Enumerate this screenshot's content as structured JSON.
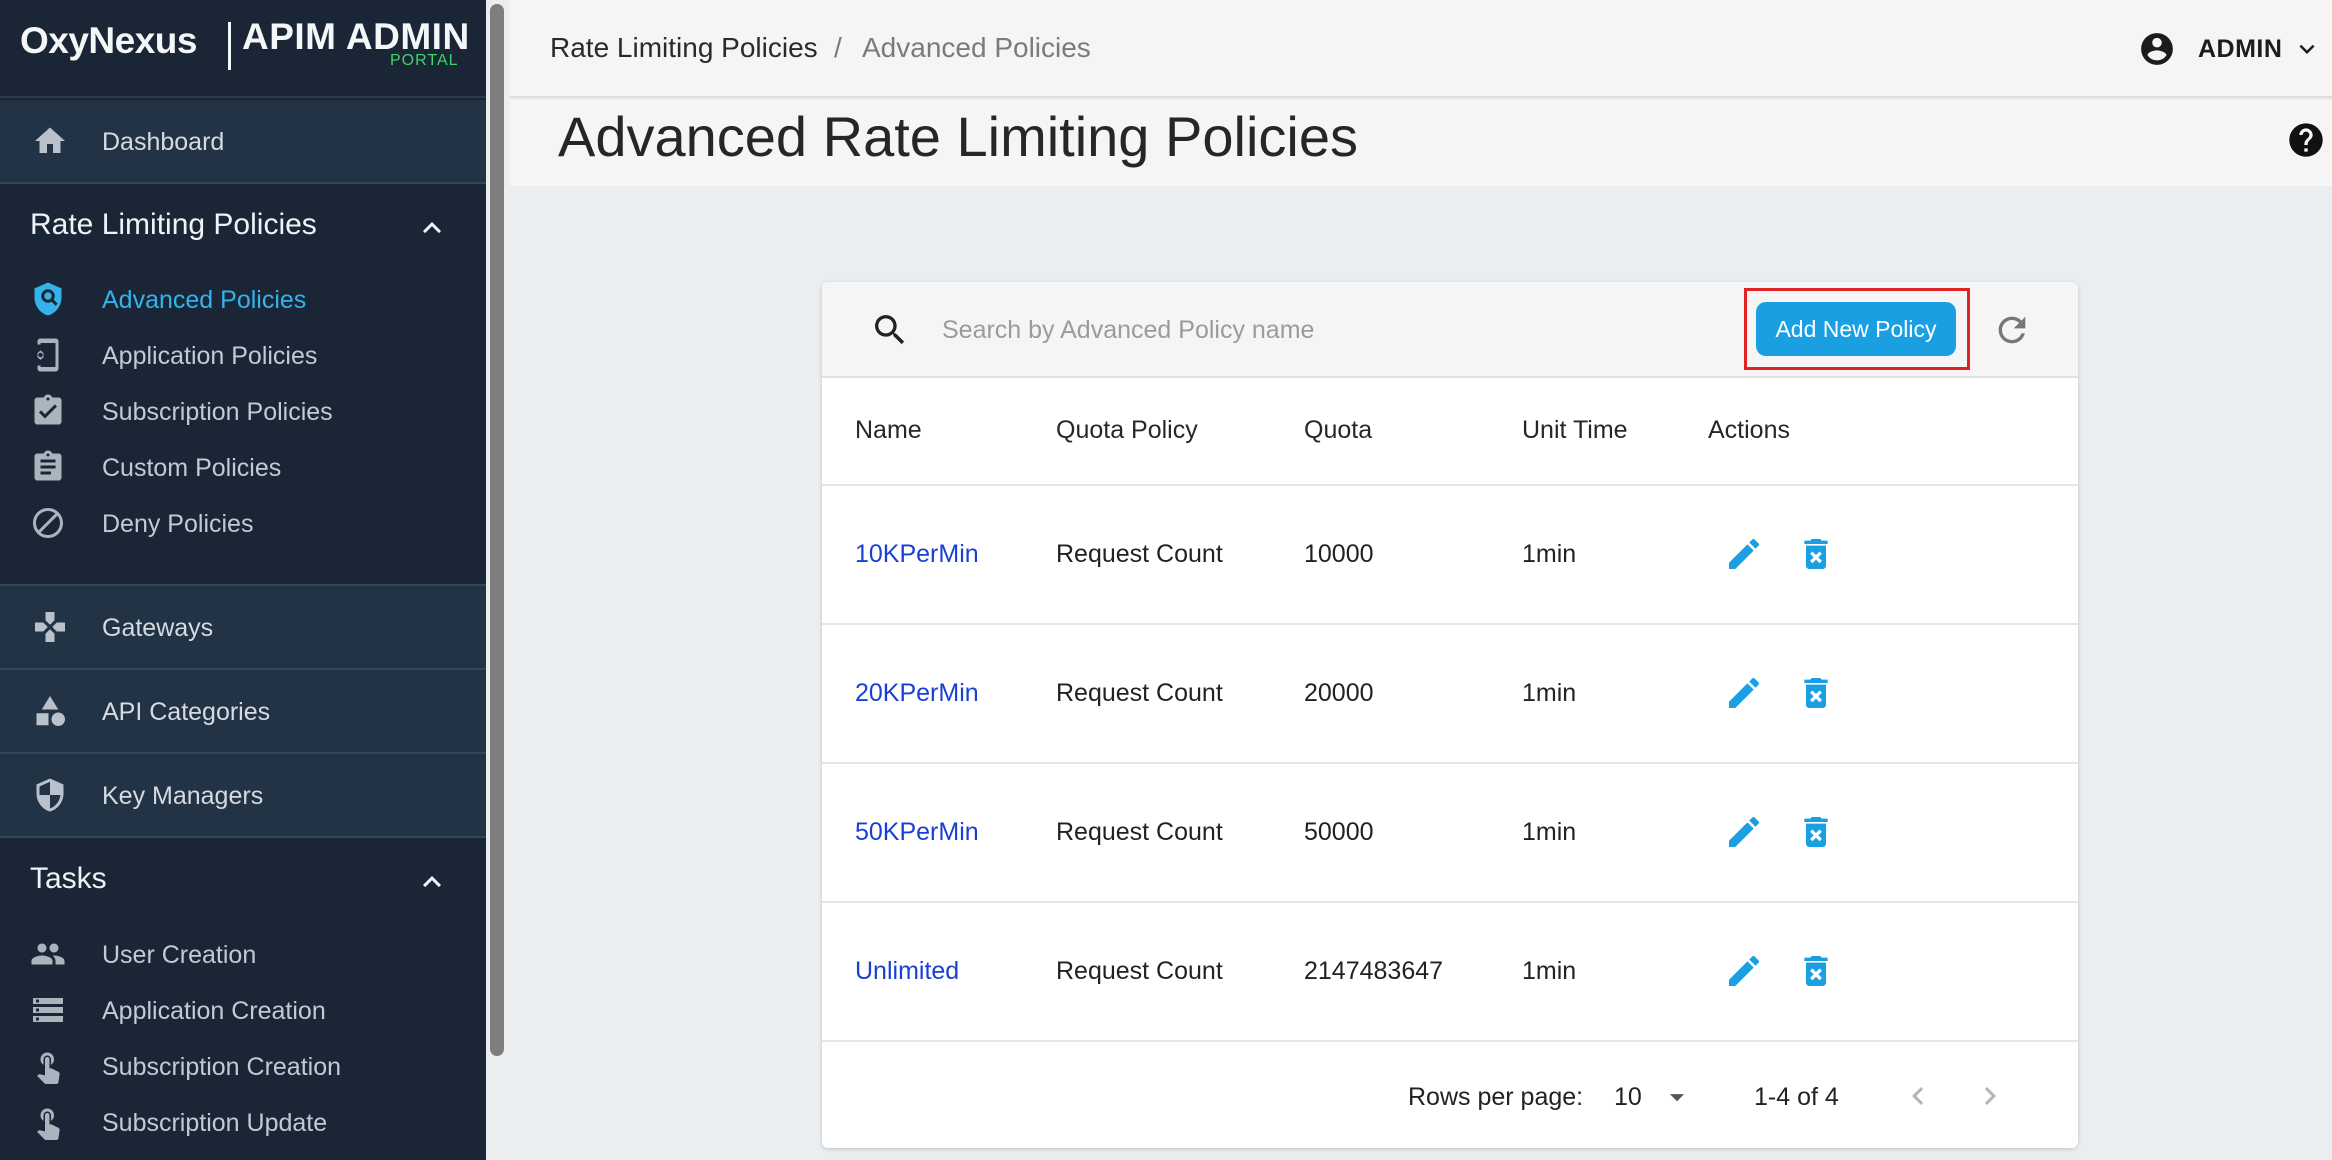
{
  "brand": {
    "logo": "OxyNexus",
    "title": "APIM ADMIN",
    "subtitle": "PORTAL"
  },
  "sidebar": {
    "dashboard": {
      "label": "Dashboard",
      "icon": "home-icon"
    },
    "rate_limiting": {
      "title": "Rate Limiting Policies",
      "items": [
        {
          "label": "Advanced Policies",
          "icon": "shield-search-icon",
          "active": true
        },
        {
          "label": "Application Policies",
          "icon": "phone-gear-icon"
        },
        {
          "label": "Subscription Policies",
          "icon": "clipboard-check-icon"
        },
        {
          "label": "Custom Policies",
          "icon": "clipboard-list-icon"
        },
        {
          "label": "Deny Policies",
          "icon": "block-icon"
        }
      ]
    },
    "gateways": {
      "label": "Gateways",
      "icon": "gateway-icon"
    },
    "api_categories": {
      "label": "API Categories",
      "icon": "categories-icon"
    },
    "key_managers": {
      "label": "Key Managers",
      "icon": "shield-half-icon"
    },
    "tasks": {
      "title": "Tasks",
      "items": [
        {
          "label": "User Creation",
          "icon": "people-icon"
        },
        {
          "label": "Application Creation",
          "icon": "storage-icon"
        },
        {
          "label": "Subscription Creation",
          "icon": "touch-icon"
        },
        {
          "label": "Subscription Update",
          "icon": "touch-icon"
        }
      ]
    }
  },
  "breadcrumb": {
    "parent": "Rate Limiting Policies",
    "separator": "/",
    "current": "Advanced Policies"
  },
  "user": {
    "name": "ADMIN"
  },
  "page": {
    "title": "Advanced Rate Limiting Policies"
  },
  "search": {
    "placeholder": "Search by Advanced Policy name",
    "value": ""
  },
  "toolbar": {
    "add_label": "Add New Policy"
  },
  "table": {
    "columns": [
      "Name",
      "Quota Policy",
      "Quota",
      "Unit Time",
      "Actions"
    ],
    "rows": [
      {
        "name": "10KPerMin",
        "quota_policy": "Request Count",
        "quota": "10000",
        "unit_time": "1min"
      },
      {
        "name": "20KPerMin",
        "quota_policy": "Request Count",
        "quota": "20000",
        "unit_time": "1min"
      },
      {
        "name": "50KPerMin",
        "quota_policy": "Request Count",
        "quota": "50000",
        "unit_time": "1min"
      },
      {
        "name": "Unlimited",
        "quota_policy": "Request Count",
        "quota": "2147483647",
        "unit_time": "1min"
      }
    ]
  },
  "pagination": {
    "rows_per_page_label": "Rows per page:",
    "rows_per_page": "10",
    "range": "1-4 of 4"
  },
  "colors": {
    "accent": "#1a9fe3",
    "sidebar_bg": "#1a2636",
    "active_nav": "#34b3ea",
    "link": "#1a3fd6",
    "highlight": "#e02222"
  }
}
